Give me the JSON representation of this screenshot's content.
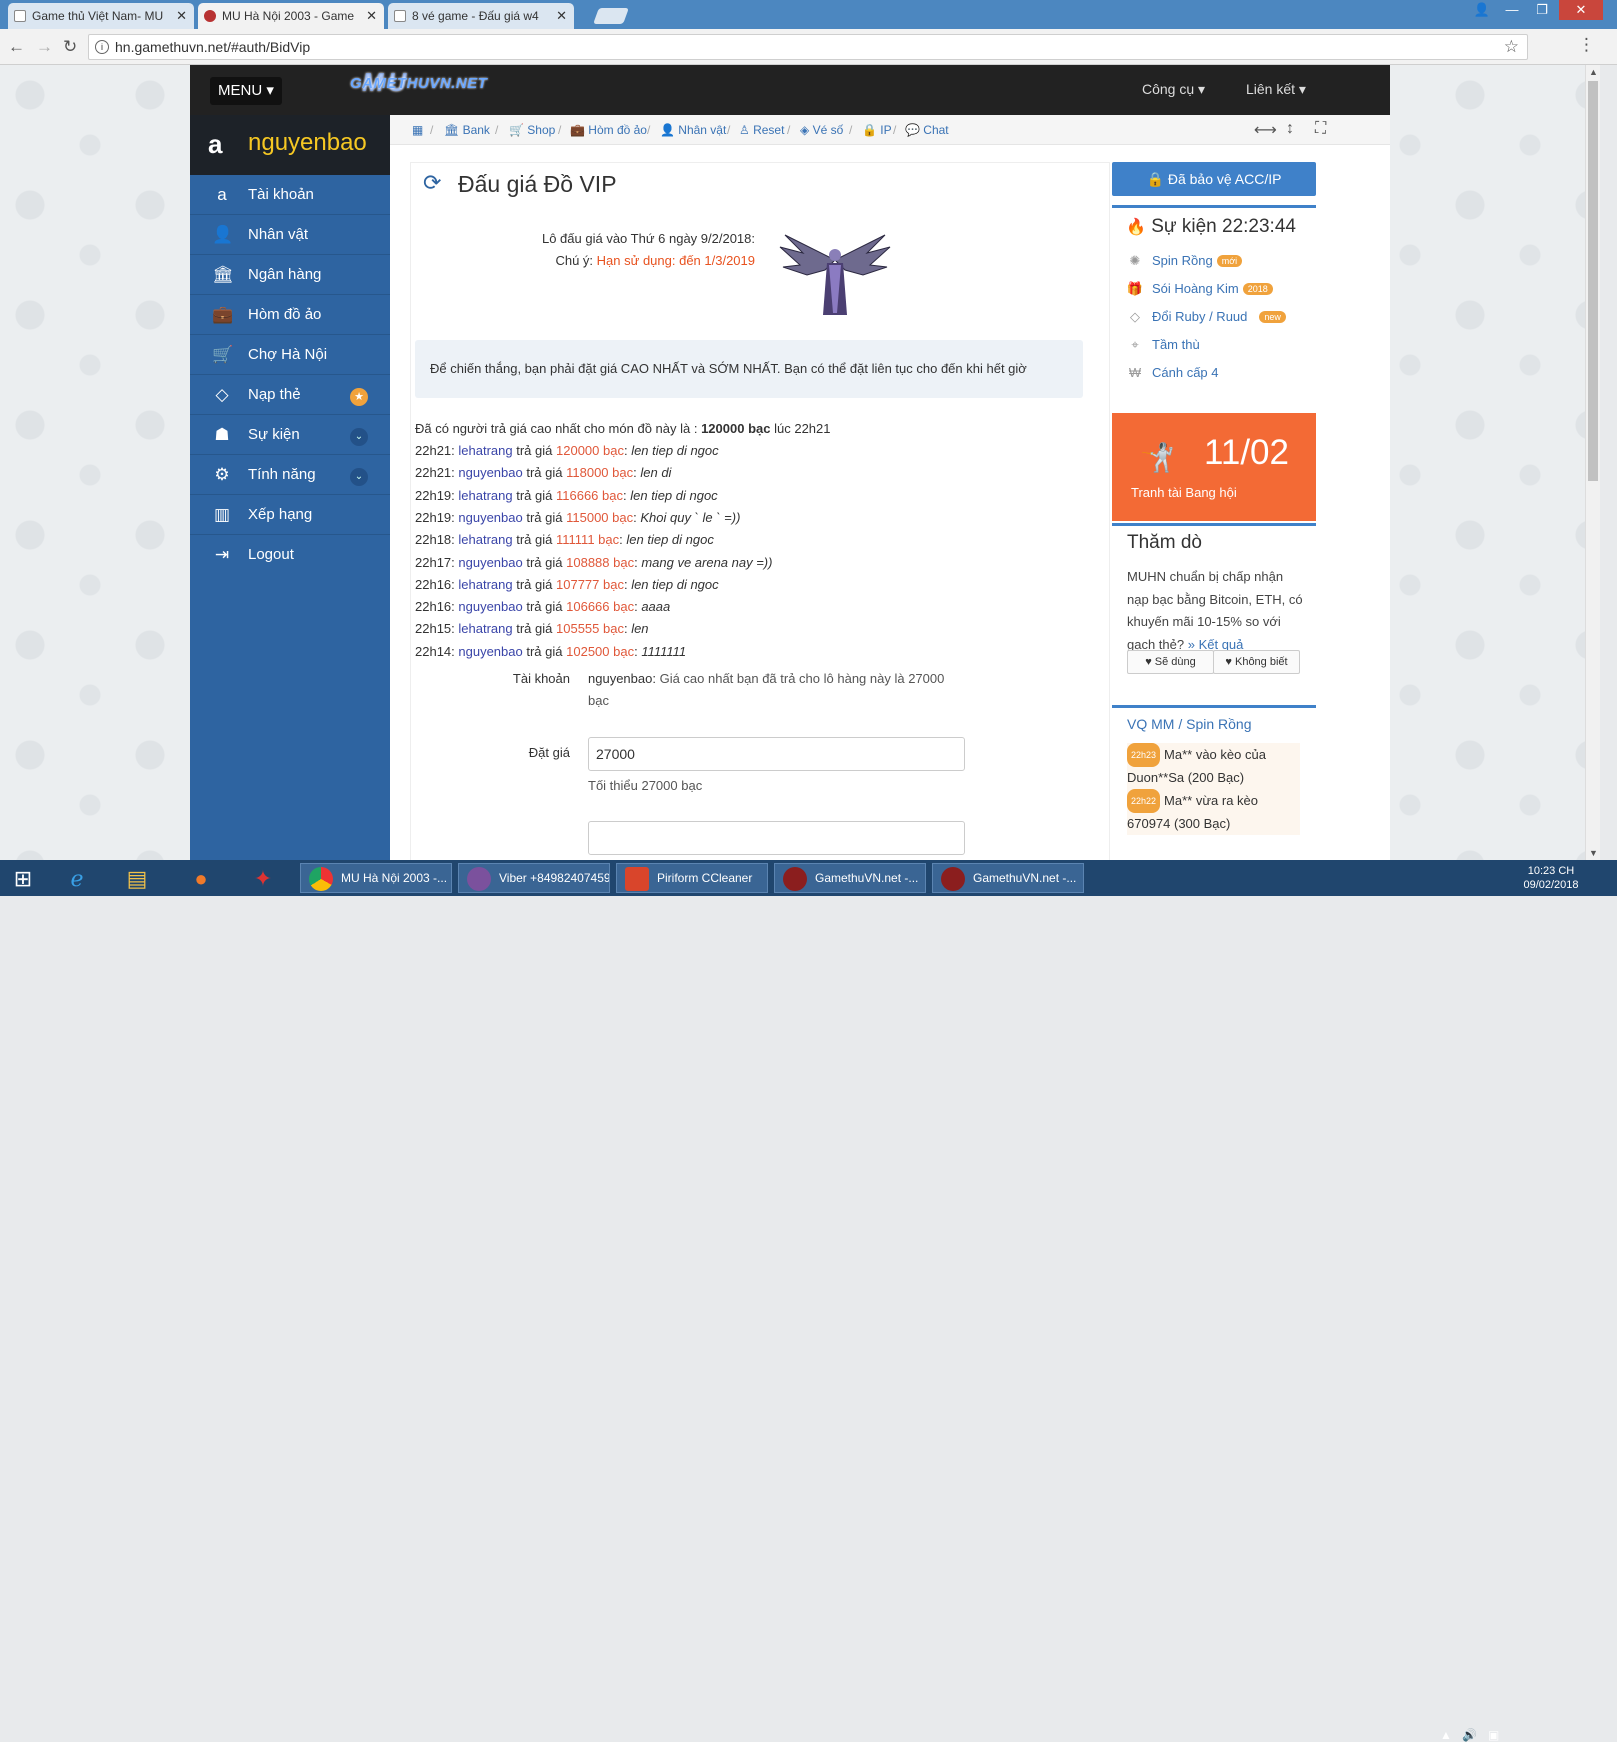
{
  "browser": {
    "tabs": [
      {
        "title": "Game thủ Việt Nam- MU"
      },
      {
        "title": "MU Hà Nội 2003 - Game"
      },
      {
        "title": "8 vé game - Đấu giá w4"
      }
    ],
    "url": "hn.gamethuvn.net/#auth/BidVip"
  },
  "topnav": {
    "menu_label": "MENU ▾",
    "logo_text": "GAMETHUVN.NET",
    "logo_mark": "MU",
    "tools_label": "Công cụ ▾",
    "links_label": "Liên kết ▾"
  },
  "sidebar": {
    "username": "nguyenbao",
    "items": [
      {
        "label": "Tài khoản",
        "icon": "amazon-icon"
      },
      {
        "label": "Nhân vật",
        "icon": "user-icon"
      },
      {
        "label": "Ngân hàng",
        "icon": "bank-icon"
      },
      {
        "label": "Hòm đồ ảo",
        "icon": "briefcase-icon"
      },
      {
        "label": "Chợ Hà Nội",
        "icon": "cart-icon"
      },
      {
        "label": "Nạp thẻ",
        "icon": "diamond-icon"
      },
      {
        "label": "Sự kiện",
        "icon": "android-icon"
      },
      {
        "label": "Tính năng",
        "icon": "gears-icon"
      },
      {
        "label": "Xếp hạng",
        "icon": "bar-chart-icon"
      },
      {
        "label": "Logout",
        "icon": "sign-out-icon"
      }
    ]
  },
  "breadcrumbs": [
    "Bank",
    "Shop",
    "Hòm đồ ảo",
    "Nhân vật",
    "Reset",
    "Vé số",
    "IP",
    "Chat"
  ],
  "auction": {
    "title": "Đấu giá Đồ VIP",
    "lot_date": "Lô đấu giá vào Thứ 6 ngày 9/2/2018:",
    "note_label": "Chú ý:",
    "note_value": "Hạn sử dụng: đến 1/3/2019",
    "rule_text": "Để chiến thắng, bạn phải đặt giá CAO NHẤT và SỚM NHẤT. Bạn có thể đặt liên tục cho đến khi hết giờ",
    "summary_prefix": "Đã có người trả giá cao nhất cho món đồ này là :",
    "summary_amount": "120000 bạc",
    "summary_suffix": "lúc 22h21",
    "bid_verb": "trả giá",
    "bids": [
      {
        "time": "22h21:",
        "user": "lehatrang",
        "amount": "120000 bạc",
        "msg": "len tiep di ngoc"
      },
      {
        "time": "22h21:",
        "user": "nguyenbao",
        "amount": "118000 bạc",
        "msg": "len di"
      },
      {
        "time": "22h19:",
        "user": "lehatrang",
        "amount": "116666 bạc",
        "msg": "len tiep di ngoc"
      },
      {
        "time": "22h19:",
        "user": "nguyenbao",
        "amount": "115000 bạc",
        "msg": "Khoi quy ` le ` =))"
      },
      {
        "time": "22h18:",
        "user": "lehatrang",
        "amount": "111111 bạc",
        "msg": "len tiep di ngoc"
      },
      {
        "time": "22h17:",
        "user": "nguyenbao",
        "amount": "108888 bạc",
        "msg": "mang ve arena nay =))"
      },
      {
        "time": "22h16:",
        "user": "lehatrang",
        "amount": "107777 bạc",
        "msg": "len tiep di ngoc"
      },
      {
        "time": "22h16:",
        "user": "nguyenbao",
        "amount": "106666 bạc",
        "msg": "aaaa"
      },
      {
        "time": "22h15:",
        "user": "lehatrang",
        "amount": "105555 bạc",
        "msg": "len"
      },
      {
        "time": "22h14:",
        "user": "nguyenbao",
        "amount": "102500 bạc",
        "msg": "1111111"
      }
    ],
    "form": {
      "account_label": "Tài khoản",
      "account_user": "nguyenbao:",
      "account_text": "Giá cao nhất bạn đã trả cho lô hàng này là 27000 bạc",
      "bid_label": "Đặt giá",
      "bid_value": "27000",
      "bid_hint": "Tối thiểu 27000 bạc"
    }
  },
  "right": {
    "protect_label": "Đã bảo vệ ACC/IP",
    "event_title": "Sự kiện 22:23:44",
    "events": [
      {
        "label": "Spin Rồng",
        "pill": "mới",
        "icon": "spinner-icon"
      },
      {
        "label": "Sói Hoàng Kim",
        "pill": "2018",
        "icon": "gift-icon"
      },
      {
        "label": "Đổi Ruby / Ruud",
        "pill": "new",
        "icon": "diamond-icon"
      },
      {
        "label": "Tầm thù",
        "pill": "",
        "icon": "crosshairs-icon"
      },
      {
        "label": "Cánh cấp 4",
        "pill": "",
        "icon": "won-icon"
      }
    ],
    "promo_date": "11/02",
    "promo_sub": "Tranh tài Bang hội",
    "poll_title": "Thăm dò",
    "poll_text": "MUHN chuẩn bị chấp nhận nạp bạc bằng Bitcoin, ETH, có khuyến mãi 10-15% so với gạch thẻ?",
    "poll_link": "» Kết quả",
    "poll_yes": "Sẽ dùng",
    "poll_no": "Không biết",
    "vq_title": "VQ MM / Spin Rồng",
    "vq_rows": [
      {
        "time": "22h23",
        "text_a": "Ma** vào kèo của",
        "text_b": "Duon**Sa (200 Bạc)"
      },
      {
        "time": "22h22",
        "text_a": "Ma** vừa ra kèo",
        "text_b": "670974 (300 Bạc)"
      }
    ]
  },
  "taskbar": {
    "tasks": [
      {
        "label": "MU Hà Nội 2003 -..."
      },
      {
        "label": "Viber +84982407459"
      },
      {
        "label": "Piriform CCleaner"
      },
      {
        "label": "GamethuVN.net -..."
      },
      {
        "label": "GamethuVN.net -..."
      }
    ],
    "time": "10:23 CH",
    "date": "09/02/2018"
  }
}
